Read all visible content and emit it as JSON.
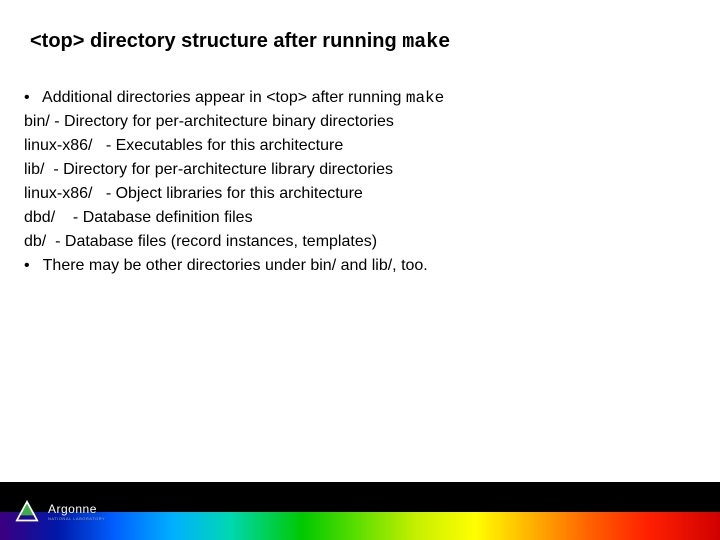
{
  "title": {
    "prefix": "<top> directory structure after running ",
    "mono": "make"
  },
  "lines": {
    "b1_pre": "•   Additional directories appear in <top> after running ",
    "b1_mono": "make",
    "l2": "bin/ - Directory for per-architecture binary directories",
    "l3": "linux-x86/   - Executables for this architecture",
    "l4": "lib/  - Directory for per-architecture library directories",
    "l5": "linux-x86/   - Object libraries for this architecture",
    "l6": "dbd/    - Database definition files",
    "l7": "db/  - Database files (record instances, templates)",
    "b8": "•   There may be other directories under bin/ and lib/, too."
  },
  "logo": {
    "name": "Argonne",
    "sub": "NATIONAL LABORATORY"
  }
}
